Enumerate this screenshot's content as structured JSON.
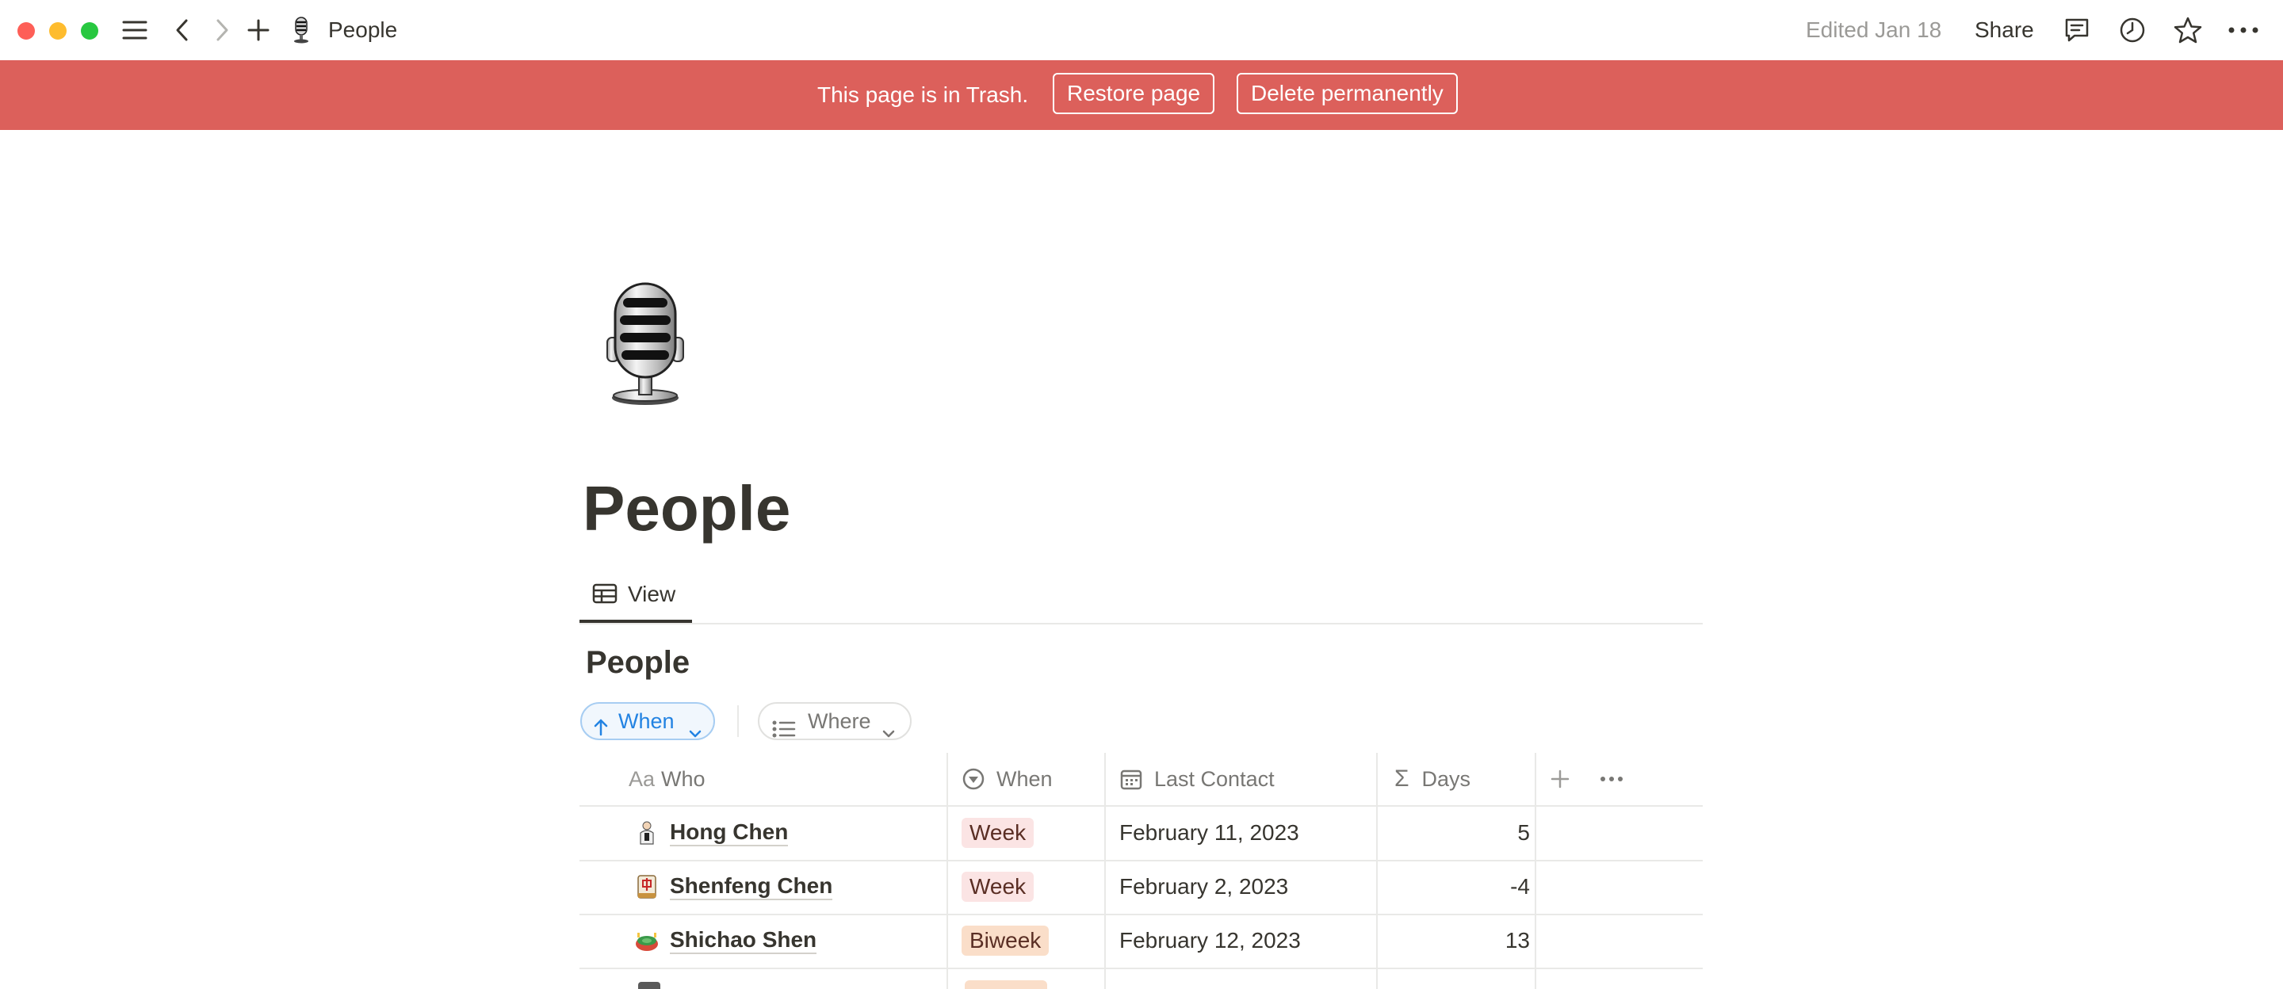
{
  "titlebar": {
    "page_name": "People",
    "edited": "Edited Jan 18",
    "share_label": "Share"
  },
  "banner": {
    "message": "This page is in Trash.",
    "restore_label": "Restore page",
    "delete_label": "Delete permanently"
  },
  "page": {
    "title": "People",
    "tab_label": "View",
    "database_title": "People",
    "filters": {
      "sort_label": "When",
      "group_label": "Where"
    }
  },
  "table": {
    "columns": {
      "who_icon": "Aa",
      "who": "Who",
      "when": "When",
      "last_contact": "Last Contact",
      "days_icon": "Σ",
      "days": "Days"
    },
    "rows": [
      {
        "name": "Hong Chen",
        "icon": "person-emoji",
        "when": "Week",
        "last_contact": "February 11, 2023",
        "days": "5"
      },
      {
        "name": "Shenfeng Chen",
        "icon": "mahjong-emoji",
        "when": "Week",
        "last_contact": "February 2, 2023",
        "days": "-4"
      },
      {
        "name": "Shichao Shen",
        "icon": "stadium-emoji",
        "when": "Biweek",
        "last_contact": "February 12, 2023",
        "days": "13"
      }
    ]
  },
  "colors": {
    "banner": "#dc605b",
    "tag_week": "#fbe4e4",
    "tag_biweek": "#fadec9",
    "accent_blue": "#2383e2"
  }
}
